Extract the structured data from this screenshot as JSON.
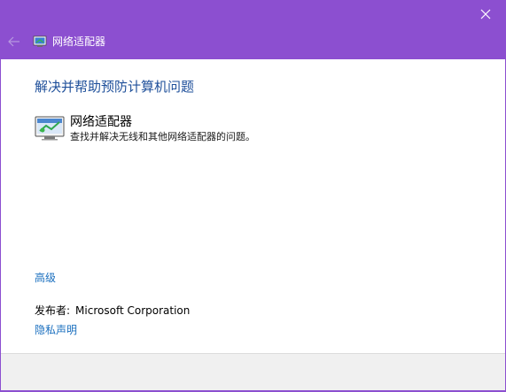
{
  "window": {
    "title": "网络适配器",
    "accent_color": "#8c4fd0",
    "icons": {
      "close": "close-icon",
      "back": "back-arrow-icon",
      "title": "network-adapter-icon"
    }
  },
  "main": {
    "heading": "解决并帮助预防计算机问题",
    "item": {
      "title": "网络适配器",
      "description": "查找并解决无线和其他网络适配器的问题。",
      "icon": "network-adapter-icon"
    },
    "advanced_link": "高级",
    "publisher_label": "发布者:",
    "publisher_value": "Microsoft Corporation",
    "privacy_link": "隐私声明"
  }
}
